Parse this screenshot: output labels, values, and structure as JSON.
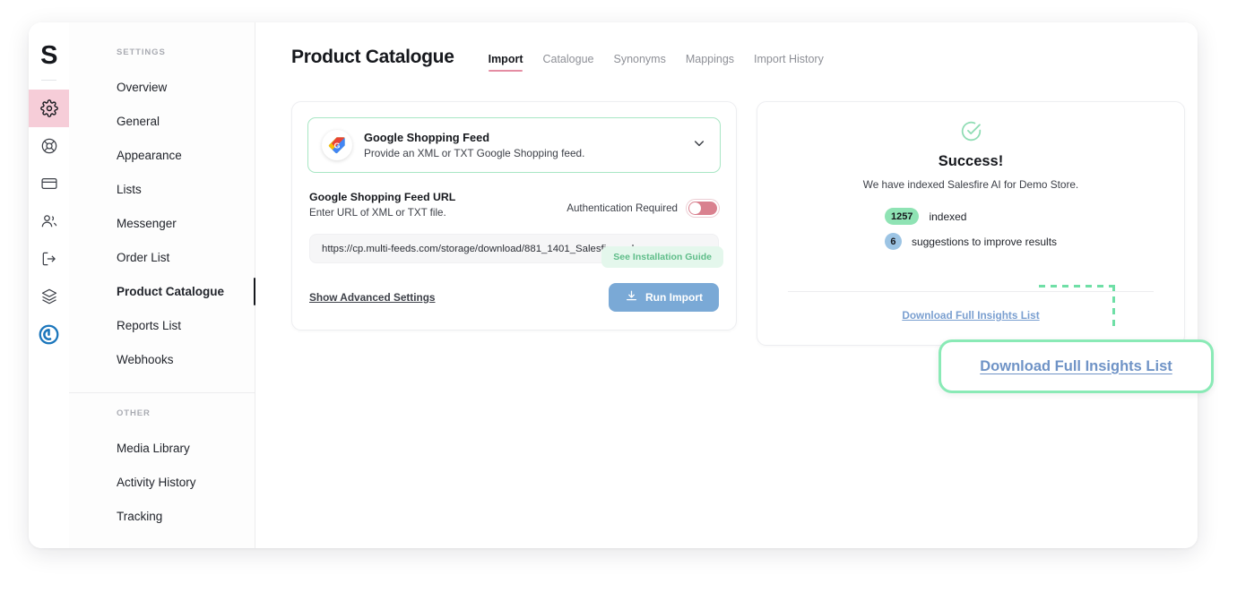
{
  "rail": {
    "brand": "S",
    "icons": [
      {
        "name": "gear-icon",
        "active": true
      },
      {
        "name": "lifebuoy-icon",
        "active": false
      },
      {
        "name": "credit-card-icon",
        "active": false
      },
      {
        "name": "users-icon",
        "active": false
      },
      {
        "name": "logout-icon",
        "active": false
      },
      {
        "name": "layers-icon",
        "active": false
      },
      {
        "name": "power-logo-icon",
        "active": false
      }
    ]
  },
  "sidebar": {
    "section_settings": "SETTINGS",
    "section_other": "OTHER",
    "settings_items": [
      {
        "label": "Overview",
        "active": false
      },
      {
        "label": "General",
        "active": false
      },
      {
        "label": "Appearance",
        "active": false
      },
      {
        "label": "Lists",
        "active": false
      },
      {
        "label": "Messenger",
        "active": false
      },
      {
        "label": "Order List",
        "active": false
      },
      {
        "label": "Product Catalogue",
        "active": true
      },
      {
        "label": "Reports List",
        "active": false
      },
      {
        "label": "Webhooks",
        "active": false
      }
    ],
    "other_items": [
      {
        "label": "Media Library"
      },
      {
        "label": "Activity History"
      },
      {
        "label": "Tracking"
      }
    ]
  },
  "header": {
    "title": "Product Catalogue",
    "tabs": [
      {
        "label": "Import",
        "active": true
      },
      {
        "label": "Catalogue",
        "active": false
      },
      {
        "label": "Synonyms",
        "active": false
      },
      {
        "label": "Mappings",
        "active": false
      },
      {
        "label": "Import History",
        "active": false
      }
    ]
  },
  "import_panel": {
    "feed_name": "Google Shopping Feed",
    "feed_desc": "Provide an XML or TXT Google Shopping feed.",
    "install_guide_label": "See Installation Guide",
    "url_label": "Google Shopping Feed URL",
    "url_hint": "Enter URL of XML or TXT file.",
    "auth_label": "Authentication Required",
    "auth_enabled": false,
    "url_value": "https://cp.multi-feeds.com/storage/download/881_1401_Salesfire.xml",
    "advanced_link": "Show Advanced Settings",
    "run_button": "Run Import",
    "run_button_color": "#7aa9d6"
  },
  "success_panel": {
    "title": "Success!",
    "subtitle": "We have indexed Salesfire AI for Demo Store.",
    "stats": [
      {
        "count": "1257",
        "label": "indexed",
        "color": "#8fe3b4"
      },
      {
        "count": "6",
        "label": "suggestions to improve results",
        "color": "#9cc4e4"
      }
    ],
    "download_link": "Download Full Insights List"
  },
  "annotation": {
    "callout_label": "Download Full Insights List",
    "accent_color": "#8aeab6"
  }
}
